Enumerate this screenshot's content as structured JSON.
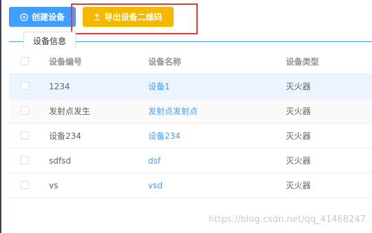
{
  "toolbar": {
    "create_label": "创建设备",
    "create_icon": "plus-circle-icon",
    "export_label": "导出设备二维码",
    "export_icon": "upload-icon"
  },
  "tabs": [
    {
      "label": "设备信息"
    }
  ],
  "table": {
    "headers": {
      "id": "设备编号",
      "name": "设备名称",
      "type": "设备类型"
    },
    "rows": [
      {
        "id": "1234",
        "name": "设备1",
        "type": "灭火器"
      },
      {
        "id": "发射点发生",
        "name": "发射点发射点",
        "type": "灭火器"
      },
      {
        "id": "设备234",
        "name": "设备234",
        "type": "灭火器"
      },
      {
        "id": "sdfsd",
        "name": "dsf",
        "type": "灭火器"
      },
      {
        "id": "vs",
        "name": "vsd",
        "type": "灭火器"
      }
    ]
  },
  "watermark": "https://blog.csdn.net/qq_41468247",
  "colors": {
    "primary": "#409eff",
    "warning": "#f5b800",
    "highlight_border": "#e03a3a",
    "row_hover": "#ecf5ff"
  }
}
